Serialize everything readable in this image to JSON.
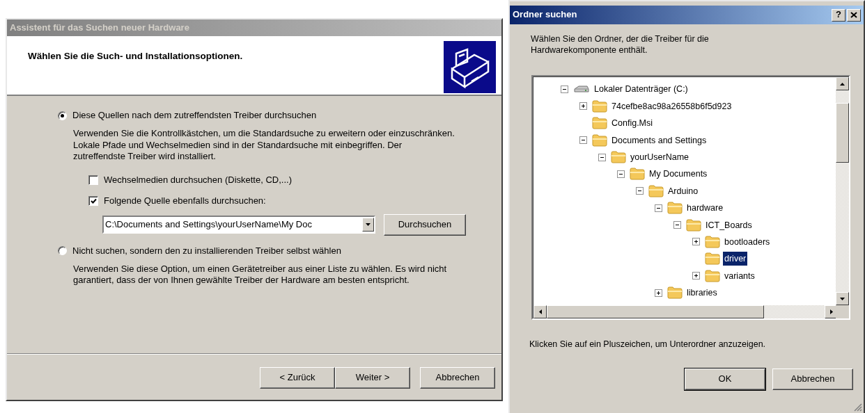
{
  "wizard": {
    "title": "Assistent für das Suchen neuer Hardware",
    "active": false,
    "heading": "Wählen Sie die Such- und Installationsoptionen.",
    "options": [
      {
        "label": "Diese Quellen nach dem zutreffendsten Treiber durchsuchen",
        "selected": true,
        "description": "Verwenden Sie die Kontrollkästchen, um die Standardsuche zu erweitern oder einzuschränken. Lokale Pfade und Wechselmedien sind in der Standardsuche mit einbegriffen. Der zutreffendste Treiber wird installiert.",
        "checkboxes": [
          {
            "label": "Wechselmedien durchsuchen (Diskette, CD,...)",
            "checked": false
          },
          {
            "label": "Folgende Quelle ebenfalls durchsuchen:",
            "checked": true
          }
        ],
        "path": {
          "value": "C:\\Documents and Settings\\yourUserName\\My Doc"
        },
        "browse_button": "Durchsuchen"
      },
      {
        "label": "Nicht suchen, sondern den zu installierenden Treiber selbst wählen",
        "selected": false,
        "description": "Verwenden Sie diese Option, um einen Gerätetreiber aus einer Liste zu wählen. Es wird nicht garantiert, dass der von Ihnen gewählte Treiber der Hardware am besten entspricht."
      }
    ],
    "buttons": [
      "< Zurück",
      "Weiter >",
      "Abbrechen"
    ]
  },
  "folder_dialog": {
    "title": "Ordner suchen",
    "active": true,
    "help_button": "?",
    "instruction": "Wählen Sie den Ordner, der die Treiber für die Hardwarekomponente enthält.",
    "tree": [
      {
        "label": "Lokaler Datenträger (C:)",
        "kind": "drive",
        "expanded": true,
        "selected": false,
        "children": [
          {
            "label": "74cefbe8ac98a26558b6f5d923",
            "kind": "folder",
            "expanded": false,
            "selected": false
          },
          {
            "label": "Config.Msi",
            "kind": "folder",
            "selected": false
          },
          {
            "label": "Documents and Settings",
            "kind": "folder",
            "expanded": true,
            "selected": false,
            "children": [
              {
                "label": "yourUserName",
                "kind": "folder",
                "expanded": true,
                "selected": false,
                "children": [
                  {
                    "label": "My Documents",
                    "kind": "folder",
                    "expanded": true,
                    "selected": false,
                    "children": [
                      {
                        "label": "Arduino",
                        "kind": "folder",
                        "expanded": true,
                        "selected": false,
                        "children": [
                          {
                            "label": "hardware",
                            "kind": "folder",
                            "expanded": true,
                            "selected": false,
                            "children": [
                              {
                                "label": "ICT_Boards",
                                "kind": "folder",
                                "expanded": true,
                                "selected": false,
                                "children": [
                                  {
                                    "label": "bootloaders",
                                    "kind": "folder",
                                    "expanded": false,
                                    "selected": false
                                  },
                                  {
                                    "label": "driver",
                                    "kind": "folder",
                                    "selected": true
                                  },
                                  {
                                    "label": "variants",
                                    "kind": "folder",
                                    "expanded": false,
                                    "selected": false
                                  }
                                ]
                              }
                            ]
                          },
                          {
                            "label": "libraries",
                            "kind": "folder",
                            "expanded": false,
                            "selected": false
                          }
                        ]
                      }
                    ]
                  }
                ]
              }
            ]
          }
        ]
      }
    ],
    "hint": "Klicken Sie auf ein Pluszeichen, um Unterordner anzuzeigen.",
    "buttons": [
      "OK",
      "Abbrechen"
    ]
  }
}
